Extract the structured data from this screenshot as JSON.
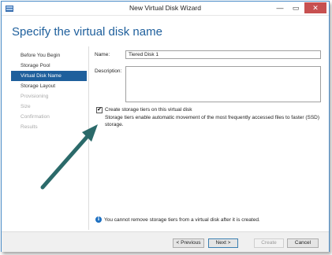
{
  "window": {
    "title": "New Virtual Disk Wizard",
    "minimize_glyph": "—",
    "maximize_glyph": "▭",
    "close_glyph": "✕"
  },
  "page": {
    "heading": "Specify the virtual disk name"
  },
  "nav": {
    "items": [
      {
        "label": "Before You Begin",
        "state": "normal"
      },
      {
        "label": "Storage Pool",
        "state": "normal"
      },
      {
        "label": "Virtual Disk Name",
        "state": "active"
      },
      {
        "label": "Storage Layout",
        "state": "normal"
      },
      {
        "label": "Provisioning",
        "state": "disabled"
      },
      {
        "label": "Size",
        "state": "disabled"
      },
      {
        "label": "Confirmation",
        "state": "disabled"
      },
      {
        "label": "Results",
        "state": "disabled"
      }
    ]
  },
  "form": {
    "name_label": "Name:",
    "name_value": "Tiered Disk 1",
    "description_label": "Description:",
    "description_value": "",
    "tiers_checkbox_checked": true,
    "tiers_checkbox_glyph": "✔",
    "tiers_checkbox_label": "Create storage tiers on this virtual disk",
    "tiers_description": "Storage tiers enable automatic movement of the most frequently accessed files to faster (SSD) storage."
  },
  "info": {
    "icon": "info-icon",
    "glyph": "i",
    "text": "You cannot remove storage tiers from a virtual disk after it is created."
  },
  "buttons": {
    "previous": "< Previous",
    "next": "Next >",
    "create": "Create",
    "cancel": "Cancel"
  },
  "colors": {
    "accent": "#1e5f9c",
    "annotation_arrow": "#2b6a6a",
    "close_button": "#c75050"
  }
}
